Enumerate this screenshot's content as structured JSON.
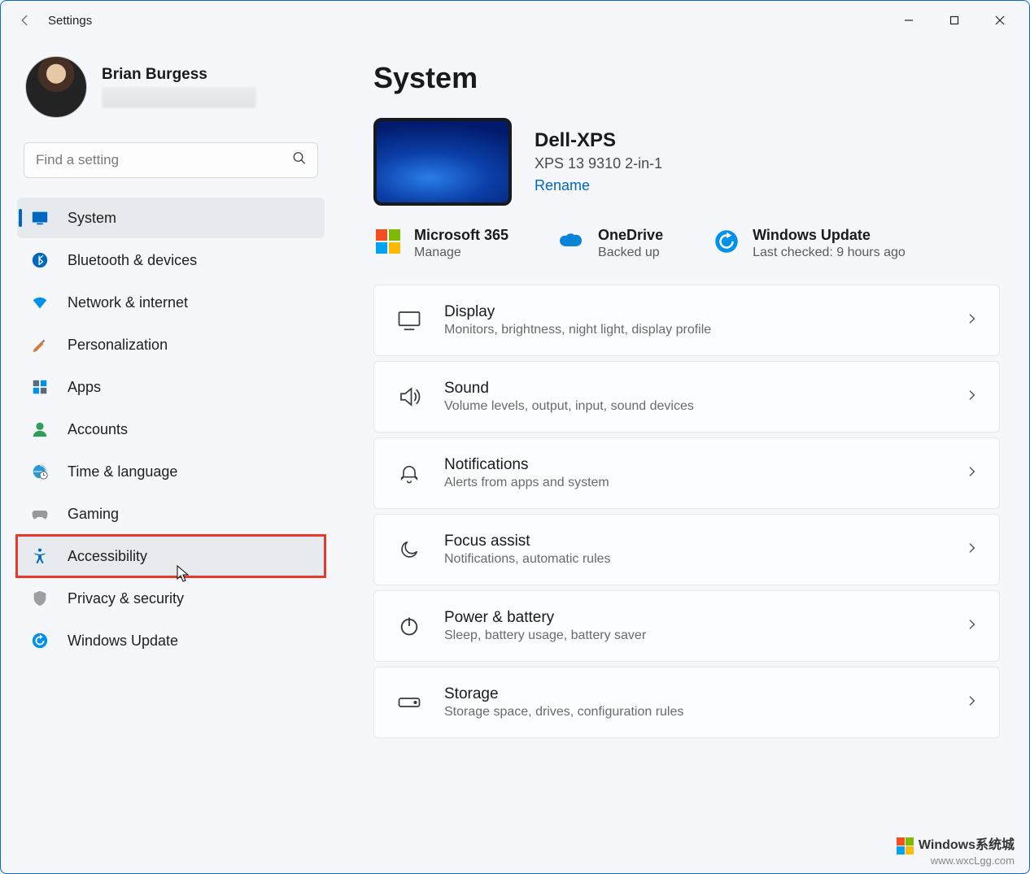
{
  "app_title": "Settings",
  "user": {
    "name": "Brian Burgess"
  },
  "search": {
    "placeholder": "Find a setting"
  },
  "sidebar": {
    "items": [
      {
        "label": "System"
      },
      {
        "label": "Bluetooth & devices"
      },
      {
        "label": "Network & internet"
      },
      {
        "label": "Personalization"
      },
      {
        "label": "Apps"
      },
      {
        "label": "Accounts"
      },
      {
        "label": "Time & language"
      },
      {
        "label": "Gaming"
      },
      {
        "label": "Accessibility"
      },
      {
        "label": "Privacy & security"
      },
      {
        "label": "Windows Update"
      }
    ]
  },
  "page": {
    "title": "System",
    "device": {
      "name": "Dell-XPS",
      "model": "XPS 13 9310 2-in-1",
      "rename": "Rename"
    },
    "status": [
      {
        "title": "Microsoft 365",
        "sub": "Manage"
      },
      {
        "title": "OneDrive",
        "sub": "Backed up"
      },
      {
        "title": "Windows Update",
        "sub": "Last checked: 9 hours ago"
      }
    ],
    "cards": [
      {
        "title": "Display",
        "sub": "Monitors, brightness, night light, display profile"
      },
      {
        "title": "Sound",
        "sub": "Volume levels, output, input, sound devices"
      },
      {
        "title": "Notifications",
        "sub": "Alerts from apps and system"
      },
      {
        "title": "Focus assist",
        "sub": "Notifications, automatic rules"
      },
      {
        "title": "Power & battery",
        "sub": "Sleep, battery usage, battery saver"
      },
      {
        "title": "Storage",
        "sub": "Storage space, drives, configuration rules"
      }
    ]
  },
  "watermark": {
    "brand": "Windows系统城",
    "url": "www.wxcLgg.com"
  }
}
